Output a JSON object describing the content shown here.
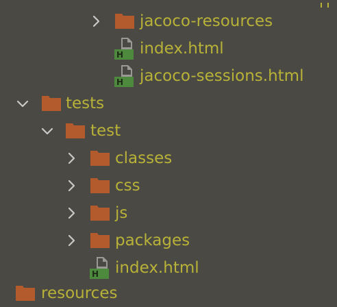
{
  "colors": {
    "background": "#4a4943",
    "label": "#b8b239",
    "folder": "#b35b2c",
    "html_badge": "#4e8a3e",
    "chevron": "#c9c9c9"
  },
  "tree": {
    "items": [
      {
        "label": "jacoco-resources",
        "type": "folder",
        "state": "collapsed",
        "icon": "folder-icon"
      },
      {
        "label": "index.html",
        "type": "html-file",
        "icon": "html-file-icon",
        "badge": "H"
      },
      {
        "label": "jacoco-sessions.html",
        "type": "html-file",
        "icon": "html-file-icon",
        "badge": "H"
      },
      {
        "label": "tests",
        "type": "folder",
        "state": "expanded",
        "icon": "folder-icon"
      },
      {
        "label": "test",
        "type": "folder",
        "state": "expanded",
        "icon": "folder-icon"
      },
      {
        "label": "classes",
        "type": "folder",
        "state": "collapsed",
        "icon": "folder-icon"
      },
      {
        "label": "css",
        "type": "folder",
        "state": "collapsed",
        "icon": "folder-icon"
      },
      {
        "label": "js",
        "type": "folder",
        "state": "collapsed",
        "icon": "folder-icon"
      },
      {
        "label": "packages",
        "type": "folder",
        "state": "collapsed",
        "icon": "folder-icon"
      },
      {
        "label": "index.html",
        "type": "html-file",
        "icon": "html-file-icon",
        "badge": "H"
      },
      {
        "label": "resources",
        "type": "folder",
        "state": "collapsed",
        "icon": "folder-icon"
      }
    ]
  }
}
